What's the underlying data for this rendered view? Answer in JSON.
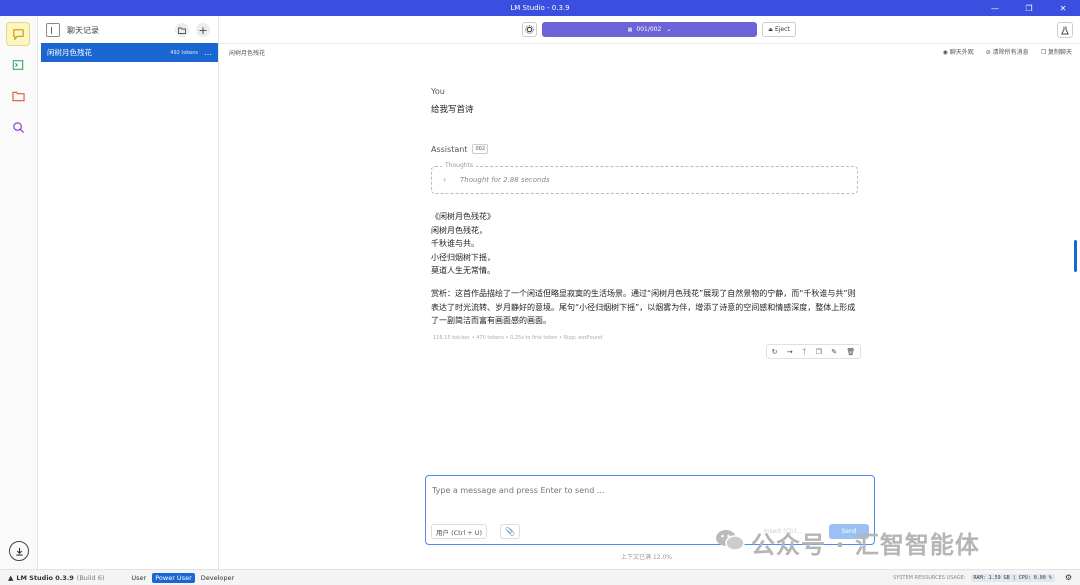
{
  "window": {
    "title": "LM Studio - 0.3.9"
  },
  "sidebar": {
    "header_label": "聊天记录",
    "chats": [
      {
        "title": "闲树月色残花",
        "tokens": "492 tokens"
      }
    ]
  },
  "topbar": {
    "model_selector": "001/002",
    "eject_label": "Eject"
  },
  "subbar": {
    "chat_title": "闲树月色残花",
    "actions": [
      "聊天外观",
      "清除所有消息",
      "复制聊天"
    ]
  },
  "conversation": {
    "user_role": "You",
    "user_message": "给我写首诗",
    "assistant_role": "Assistant",
    "assistant_badge": "002",
    "thoughts_label": "Thoughts",
    "thoughts_summary": "Thought for 2.88 seconds",
    "poem_lines": [
      "《闲树月色残花》",
      "闲树月色残花，",
      "千秋谁与共。",
      "小径归烟树下摇，",
      "莫道人生无常情。"
    ],
    "analysis": "赏析：这首作品描绘了一个闲适但略显寂寞的生活场景。通过“闲树月色残花”展现了自然景物的宁静，而“千秋谁与共”则表达了时光流转、岁月静好的意境。尾句“小径归烟树下摇”，以烟雾为伴，增添了诗意的空间感和情感深度，整体上形成了一副简洁而富有画面感的画面。",
    "stats": "116.15 tok/sec • 470 tokens • 0.25s to first token • Stop: eosFound"
  },
  "composer": {
    "placeholder": "Type a message and press Enter to send ...",
    "role_button": "用户 (Ctrl + U)",
    "insert_label": "Insert (Ctrl...",
    "send_label": "Send"
  },
  "context_usage": "上下文已满 12.0%",
  "statusbar": {
    "app_version": "LM Studio 0.3.9",
    "build": "(Build 6)",
    "modes": [
      "User",
      "Power User",
      "Developer"
    ],
    "active_mode": "Power User",
    "resources_label": "SYSTEM RESOURCES USAGE:",
    "ram": "RAM: 1.59 GB",
    "cpu": "CPU: 0.00 %"
  },
  "watermark": "公众号 · 汇智智能体",
  "colors": {
    "accent": "#1a67d2",
    "model_bar": "#6b63d6",
    "titlebar": "#3a4fe0"
  }
}
